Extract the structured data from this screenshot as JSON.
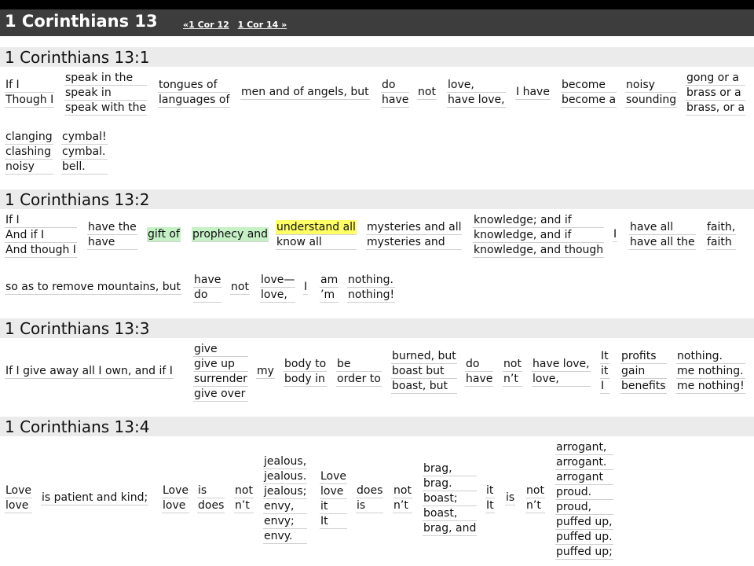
{
  "header": {
    "title": "1 Corinthians 13",
    "prev_link": "«1 Cor 12",
    "next_link": "1 Cor 14 »"
  },
  "verses": {
    "v1": {
      "heading": "1 Corinthians 13:1",
      "g1": [
        "If I",
        "Though I"
      ],
      "g2": [
        "speak in the",
        "speak in",
        "speak with the"
      ],
      "g3": [
        "tongues of",
        "languages of"
      ],
      "g4": [
        "men and of angels, but"
      ],
      "g5": [
        "do",
        "have"
      ],
      "g6": [
        "not"
      ],
      "g7": [
        "love,",
        "have love,"
      ],
      "g8": [
        "I have"
      ],
      "g9": [
        "become",
        "become a"
      ],
      "g10": [
        "noisy",
        "sounding"
      ],
      "g11": [
        "gong or a",
        "brass or a",
        "brass, or a"
      ],
      "g12": [
        "clanging",
        "clashing",
        "noisy"
      ],
      "g13": [
        "cymbal!",
        "cymbal.",
        "bell."
      ]
    },
    "v2": {
      "heading": "1 Corinthians 13:2",
      "g1": [
        "If I",
        "And if I",
        "And though I"
      ],
      "g2": [
        "have the",
        "have"
      ],
      "g3": [
        "gift of"
      ],
      "g4": [
        "prophecy and"
      ],
      "g5": [
        "understand all",
        "know all"
      ],
      "g6": [
        "mysteries and all",
        "mysteries and"
      ],
      "g7": [
        "knowledge; and if",
        "knowledge, and if",
        "knowledge, and though"
      ],
      "g8": [
        "I"
      ],
      "g9": [
        "have all",
        "have all the"
      ],
      "g10": [
        "faith,",
        "faith"
      ],
      "g11": [
        "so as to remove mountains, but"
      ],
      "g12": [
        "have",
        "do"
      ],
      "g13": [
        "not"
      ],
      "g14": [
        "love—",
        "love,"
      ],
      "g15": [
        "I"
      ],
      "g16": [
        "am",
        "’m"
      ],
      "g17": [
        "nothing.",
        "nothing!"
      ]
    },
    "v3": {
      "heading": "1 Corinthians 13:3",
      "g1": [
        "If I give away all I own, and if I"
      ],
      "g2": [
        "give",
        "give up",
        "surrender",
        "give over"
      ],
      "g3": [
        "my"
      ],
      "g4": [
        "body to",
        "body in"
      ],
      "g5": [
        "be",
        "order to"
      ],
      "g6": [
        "burned, but",
        "boast but",
        "boast, but"
      ],
      "g7": [
        "do",
        "have"
      ],
      "g8": [
        "not",
        "n’t"
      ],
      "g9": [
        "have love,",
        "love,"
      ],
      "g10": [
        "It",
        "it",
        "I"
      ],
      "g11": [
        "profits",
        "gain",
        "benefits"
      ],
      "g12": [
        "nothing.",
        "me nothing.",
        "me nothing!"
      ]
    },
    "v4": {
      "heading": "1 Corinthians 13:4",
      "g1": [
        "Love",
        "love"
      ],
      "g2": [
        "is patient and kind;"
      ],
      "g3": [
        "Love",
        "love"
      ],
      "g4": [
        "is",
        "does"
      ],
      "g5": [
        "not",
        "n’t"
      ],
      "g6": [
        "jealous,",
        "jealous.",
        "jealous;",
        "envy,",
        "envy;",
        "envy."
      ],
      "g7": [
        "Love",
        "love",
        "it",
        "It"
      ],
      "g8": [
        "does",
        "is"
      ],
      "g9": [
        "not",
        "n’t"
      ],
      "g10": [
        "brag,",
        "brag.",
        "boast;",
        "boast,",
        "brag, and"
      ],
      "g11": [
        "it",
        "It"
      ],
      "g12": [
        "is"
      ],
      "g13": [
        "not",
        "n’t"
      ],
      "g14": [
        "arrogant,",
        "arrogant.",
        "arrogant",
        "proud.",
        "proud,",
        "puffed up,",
        "puffed up.",
        "puffed up;"
      ]
    }
  },
  "colors": {
    "header_bg": "#3d3d3d",
    "verse_heading_bg": "#ebebeb",
    "highlight_yellow": "#ffff66",
    "highlight_green": "#c6f0c6"
  }
}
